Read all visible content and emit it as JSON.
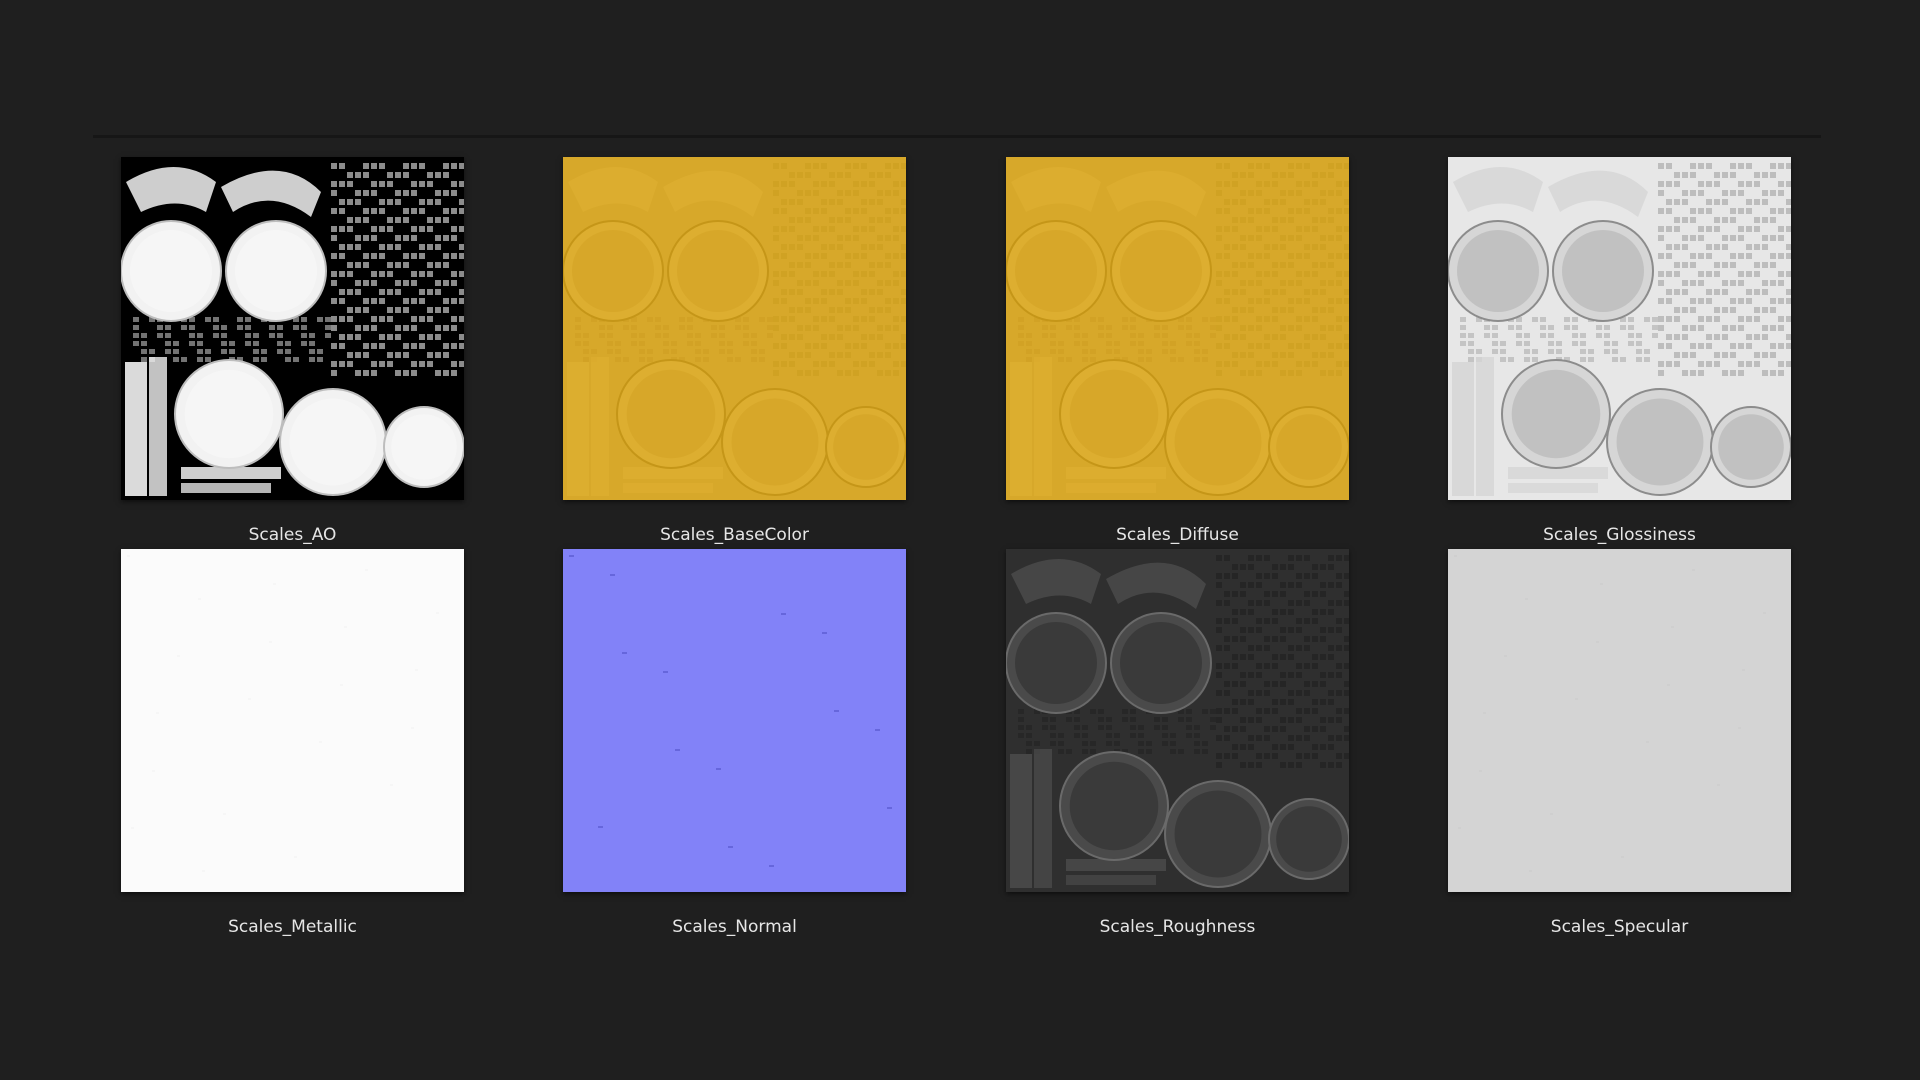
{
  "textures": [
    {
      "name": "Scales_AO",
      "style": "ao",
      "base": "#000000"
    },
    {
      "name": "Scales_BaseColor",
      "style": "color",
      "base": "#d7a82a"
    },
    {
      "name": "Scales_Diffuse",
      "style": "color",
      "base": "#d7a82a"
    },
    {
      "name": "Scales_Glossiness",
      "style": "gloss",
      "base": "#e7e7e7"
    },
    {
      "name": "Scales_Metallic",
      "style": "flat",
      "base": "#fbfbfb"
    },
    {
      "name": "Scales_Normal",
      "style": "normal",
      "base": "#8282f8"
    },
    {
      "name": "Scales_Roughness",
      "style": "rough",
      "base": "#2f2f2f"
    },
    {
      "name": "Scales_Specular",
      "style": "flat",
      "base": "#d4d4d4"
    }
  ]
}
